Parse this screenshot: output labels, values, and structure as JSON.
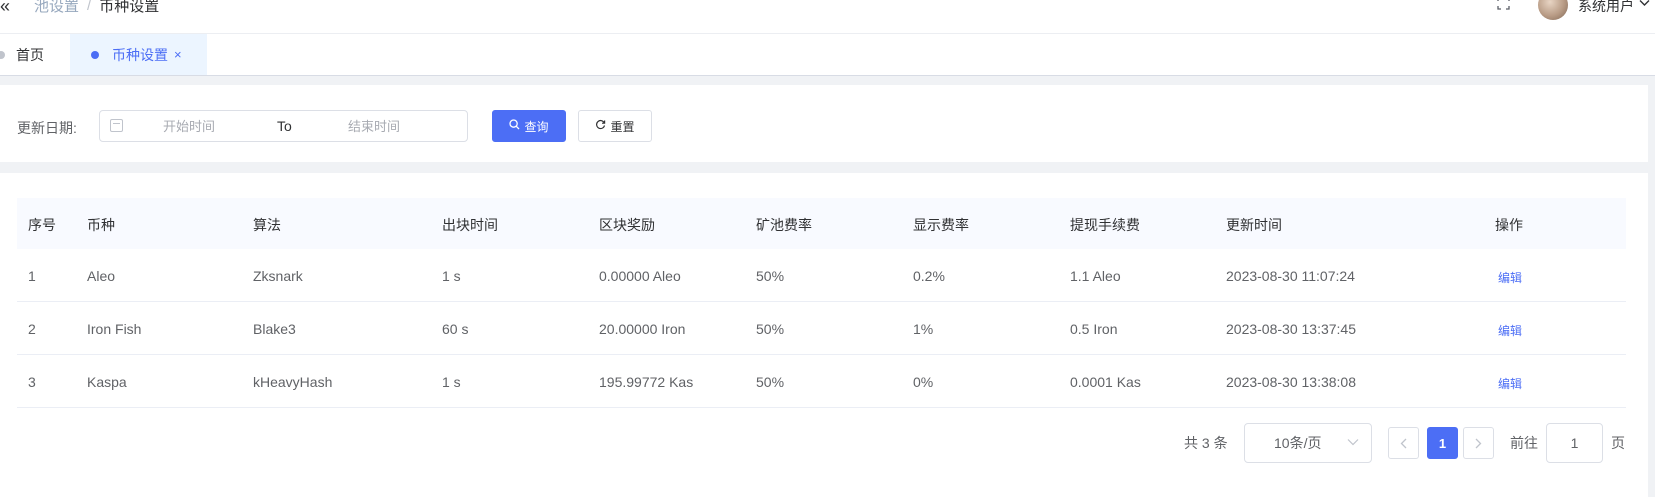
{
  "header": {
    "breadcrumb": [
      "池设置",
      "币种设置"
    ],
    "breadcrumb_sep": "/",
    "user_name": "系统用户"
  },
  "tabs": [
    {
      "label": "首页",
      "active": false
    },
    {
      "label": "币种设置",
      "active": true
    }
  ],
  "search": {
    "date_label": "更新日期:",
    "start_placeholder": "开始时间",
    "range_sep": "To",
    "end_placeholder": "结束时间",
    "query_label": "查询",
    "reset_label": "重置"
  },
  "table": {
    "columns": [
      "序号",
      "币种",
      "算法",
      "出块时间",
      "区块奖励",
      "矿池费率",
      "显示费率",
      "提现手续费",
      "更新时间",
      "操作"
    ],
    "rows": [
      {
        "no": "1",
        "coin": "Aleo",
        "algo": "Zksnark",
        "block_time": "1 s",
        "reward": "0.00000 Aleo",
        "pool_fee": "50%",
        "display_fee": "0.2%",
        "withdraw_fee": "1.1 Aleo",
        "updated": "2023-08-30 11:07:24",
        "action": "编辑"
      },
      {
        "no": "2",
        "coin": "Iron Fish",
        "algo": "Blake3",
        "block_time": "60 s",
        "reward": "20.00000 Iron",
        "pool_fee": "50%",
        "display_fee": "1%",
        "withdraw_fee": "0.5 Iron",
        "updated": "2023-08-30 13:37:45",
        "action": "编辑"
      },
      {
        "no": "3",
        "coin": "Kaspa",
        "algo": "kHeavyHash",
        "block_time": "1 s",
        "reward": "195.99772 Kas",
        "pool_fee": "50%",
        "display_fee": "0%",
        "withdraw_fee": "0.0001 Kas",
        "updated": "2023-08-30 13:38:08",
        "action": "编辑"
      }
    ]
  },
  "pagination": {
    "total_text": "共 3 条",
    "page_size": "10条/页",
    "current_page": "1",
    "goto_label": "前往",
    "goto_value": "1",
    "goto_suffix": "页"
  },
  "colors": {
    "primary": "#4c6ef5"
  }
}
